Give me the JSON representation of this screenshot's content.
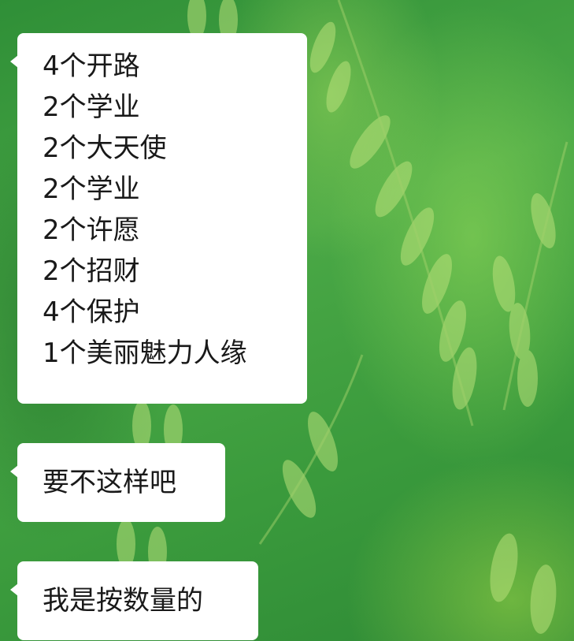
{
  "conversation": {
    "messages": [
      {
        "lines": [
          "4个开路",
          "2个学业",
          "2个大天使",
          "2个学业",
          "2个许愿",
          "2个招财",
          "4个保护",
          "1个美丽魅力人缘"
        ]
      },
      {
        "text": "要不这样吧"
      },
      {
        "text": "我是按数量的"
      }
    ]
  }
}
